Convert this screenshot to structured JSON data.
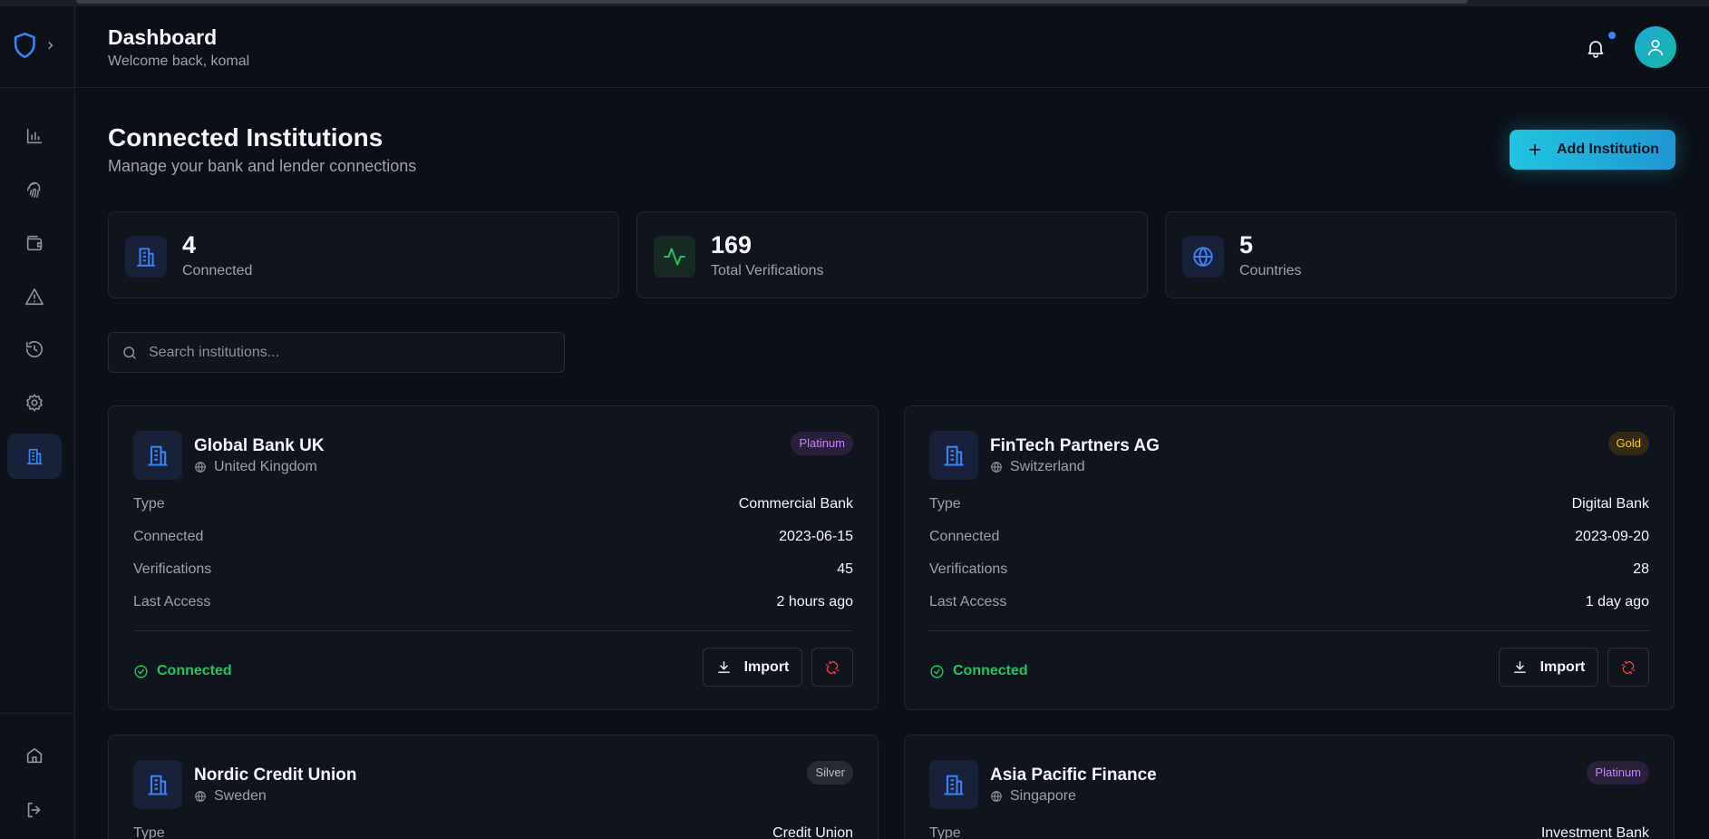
{
  "header": {
    "title": "Dashboard",
    "subtitle": "Welcome back, komal"
  },
  "sidebar": {
    "items": [
      {
        "name": "analytics",
        "icon": "bar-chart-icon"
      },
      {
        "name": "biometrics",
        "icon": "fingerprint-icon"
      },
      {
        "name": "wallet",
        "icon": "wallet-icon"
      },
      {
        "name": "alerts",
        "icon": "warning-icon"
      },
      {
        "name": "history",
        "icon": "history-icon"
      },
      {
        "name": "settings",
        "icon": "gear-icon"
      },
      {
        "name": "institutions",
        "icon": "building-icon",
        "active": true
      }
    ],
    "bottom_items": [
      {
        "name": "home",
        "icon": "home-icon"
      },
      {
        "name": "logout",
        "icon": "logout-icon"
      }
    ]
  },
  "page": {
    "title": "Connected Institutions",
    "subtitle": "Manage your bank and lender connections",
    "add_button_label": "Add Institution"
  },
  "stats": [
    {
      "value": "4",
      "label": "Connected",
      "icon": "building-icon"
    },
    {
      "value": "169",
      "label": "Total Verifications",
      "icon": "activity-icon"
    },
    {
      "value": "5",
      "label": "Countries",
      "icon": "globe-icon"
    }
  ],
  "search": {
    "placeholder": "Search institutions..."
  },
  "field_labels": {
    "type": "Type",
    "connected": "Connected",
    "verifications": "Verifications",
    "last_access": "Last Access"
  },
  "import_label": "Import",
  "institutions": [
    {
      "name": "Global Bank UK",
      "country": "United Kingdom",
      "tier": "Platinum",
      "type": "Commercial Bank",
      "connected": "2023-06-15",
      "verifications": "45",
      "last_access": "2 hours ago",
      "status": "Connected"
    },
    {
      "name": "FinTech Partners AG",
      "country": "Switzerland",
      "tier": "Gold",
      "type": "Digital Bank",
      "connected": "2023-09-20",
      "verifications": "28",
      "last_access": "1 day ago",
      "status": "Connected"
    },
    {
      "name": "Nordic Credit Union",
      "country": "Sweden",
      "tier": "Silver",
      "type": "Credit Union"
    },
    {
      "name": "Asia Pacific Finance",
      "country": "Singapore",
      "tier": "Platinum",
      "type": "Investment Bank"
    }
  ],
  "colors": {
    "accent": "#20c5e0",
    "primary_blue": "#3b82f6",
    "success": "#22c55e",
    "danger": "#ef4444",
    "platinum": "#c084fc",
    "gold": "#facc15",
    "silver": "#b9c0cb"
  }
}
